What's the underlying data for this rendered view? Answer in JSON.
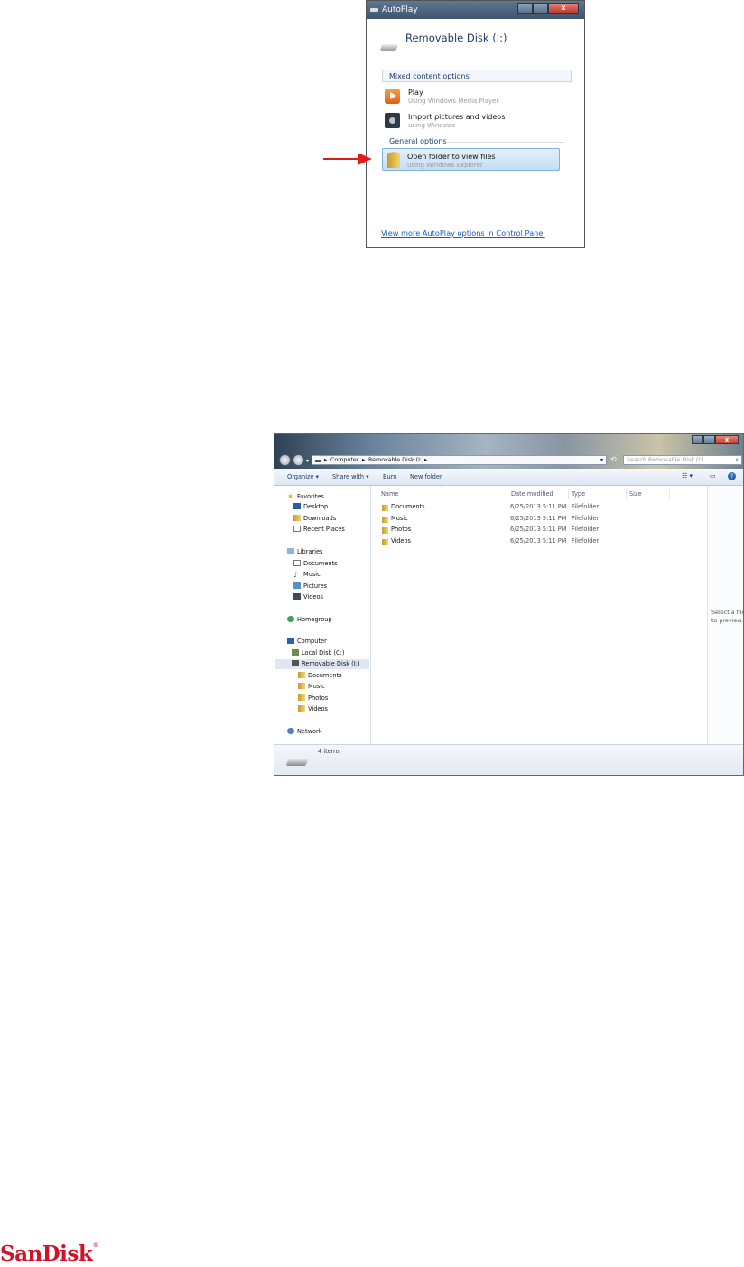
{
  "autoplay": {
    "title": "AutoPlay",
    "device": "Removable Disk (I:)",
    "mixed_content_header": "Mixed content options",
    "items": [
      {
        "label": "Play",
        "sub": "Using Windows Media Player",
        "icon": "media-player-icon"
      },
      {
        "label": "Import pictures and videos",
        "sub": "using Windows",
        "icon": "camera-icon"
      }
    ],
    "general_header": "General options",
    "selected_option": {
      "label": "Open folder to view files",
      "sub": "using Windows Explorer"
    },
    "control_panel_link": "View more AutoPlay options in Control Panel",
    "close_glyph": "x"
  },
  "explorer": {
    "breadcrumb": [
      "Computer",
      "Removable Disk (I:)"
    ],
    "breadcrumb_sep": "▸",
    "search_placeholder": "Search Removable Disk (I:)",
    "toolbar": {
      "organize": "Organize ▾",
      "share": "Share with ▾",
      "burn": "Burn",
      "new_folder": "New folder"
    },
    "sidebar": [
      {
        "label": "Favorites",
        "icon": "star-icon",
        "level": 0
      },
      {
        "label": "Desktop",
        "icon": "desktop-icon",
        "level": 1
      },
      {
        "label": "Downloads",
        "icon": "downloads-icon",
        "level": 1
      },
      {
        "label": "Recent Places",
        "icon": "recent-places-icon",
        "level": 1
      },
      {
        "label": "Libraries",
        "icon": "libraries-icon",
        "level": 0
      },
      {
        "label": "Documents",
        "icon": "documents-icon",
        "level": 1
      },
      {
        "label": "Music",
        "icon": "music-icon",
        "level": 1
      },
      {
        "label": "Pictures",
        "icon": "pictures-icon",
        "level": 1
      },
      {
        "label": "Videos",
        "icon": "videos-icon",
        "level": 1
      },
      {
        "label": "Homegroup",
        "icon": "homegroup-icon",
        "level": 0
      },
      {
        "label": "Computer",
        "icon": "computer-icon",
        "level": 0
      },
      {
        "label": "Local Disk (C:)",
        "icon": "local-disk-icon",
        "level": 1
      },
      {
        "label": "Removable Disk (I:)",
        "icon": "removable-disk-icon",
        "level": 1,
        "selected": true
      },
      {
        "label": "Documents",
        "icon": "folder-icon",
        "level": 2
      },
      {
        "label": "Music",
        "icon": "folder-icon",
        "level": 2
      },
      {
        "label": "Photos",
        "icon": "folder-icon",
        "level": 2
      },
      {
        "label": "Videos",
        "icon": "folder-icon",
        "level": 2
      },
      {
        "label": "Network",
        "icon": "network-icon",
        "level": 0
      }
    ],
    "columns": [
      "Name",
      "Date modified",
      "Type",
      "Size"
    ],
    "files": [
      {
        "name": "Documents",
        "date": "6/25/2013 5:11 PM",
        "type": "Filefolder"
      },
      {
        "name": "Music",
        "date": "6/25/2013 5:11 PM",
        "type": "Filefolder"
      },
      {
        "name": "Photos",
        "date": "6/25/2013 5:11 PM",
        "type": "Filefolder"
      },
      {
        "name": "Videos",
        "date": "6/25/2013 5:11 PM",
        "type": "Filefolder"
      }
    ],
    "preview": [
      "Select a file",
      "to preview."
    ],
    "status": "4 items"
  },
  "brand": {
    "name": "SanDisk",
    "mark": "®",
    "color": "#d3122a"
  }
}
